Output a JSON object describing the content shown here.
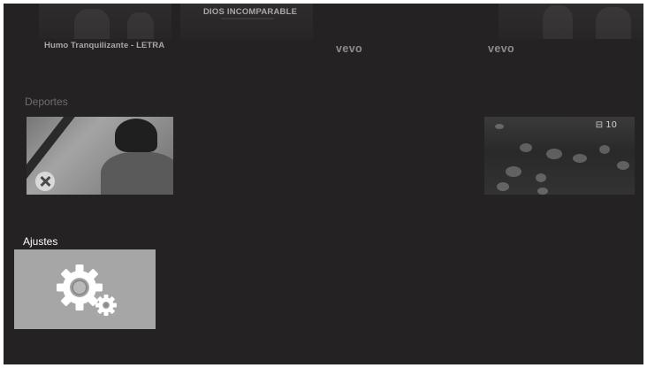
{
  "top_row": {
    "album_title": "DIOS INCOMPARABLE",
    "caption_1": "Humo Tranquilizante - LETRA",
    "vevo_1": "vevo",
    "vevo_2": "vevo"
  },
  "sections": {
    "sports": {
      "label": "Deportes",
      "scoreboard_text": "⊟ 10"
    },
    "settings": {
      "label": "Ajustes"
    }
  },
  "colors": {
    "background": "#242223",
    "settings_tile": "#a6a6a6",
    "label_active": "#ffffff",
    "label_dim": "#6f6d6d"
  },
  "icons": {
    "settings": "gear-icon",
    "sports_overlay": "close-icon"
  }
}
